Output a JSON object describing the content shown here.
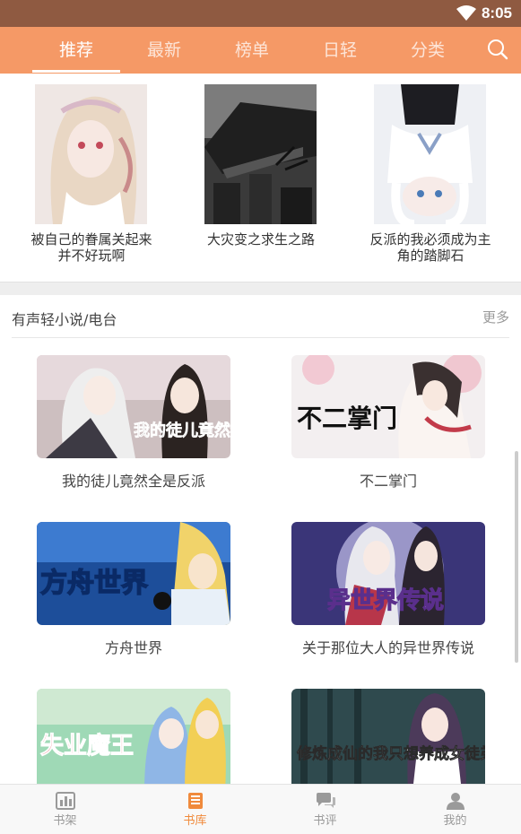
{
  "status": {
    "time": "8:05",
    "wifi_icon": "wifi-icon"
  },
  "nav": {
    "tabs": [
      {
        "label": "推荐",
        "active": true
      },
      {
        "label": "最新"
      },
      {
        "label": "榜单"
      },
      {
        "label": "日轻"
      },
      {
        "label": "分类"
      }
    ],
    "search_icon": "search-icon",
    "accent_color": "#f59966"
  },
  "books": [
    {
      "title": "被自己的眷属关起来并不好玩啊"
    },
    {
      "title": "大灾变之求生之路"
    },
    {
      "title": "反派的我必须成为主角的踏脚石"
    }
  ],
  "audio_section": {
    "title": "有声轻小说/电台",
    "more": "更多",
    "items": [
      {
        "title": "我的徒儿竟然全是反派",
        "cover_text": "我的徒儿竟然全是反派"
      },
      {
        "title": "不二掌门",
        "cover_text": "不二掌门"
      },
      {
        "title": "方舟世界",
        "cover_text": "方舟世界"
      },
      {
        "title": "关于那位大人的异世界传说",
        "cover_text": "异世界传说"
      },
      {
        "title": "",
        "cover_text": "失业魔王"
      },
      {
        "title": "",
        "cover_text": "修炼成仙的我只想养成女徒弟"
      }
    ]
  },
  "bottom_nav": [
    {
      "label": "书架",
      "icon": "bookshelf-icon"
    },
    {
      "label": "书库",
      "icon": "library-icon",
      "active": true
    },
    {
      "label": "书评",
      "icon": "comments-icon"
    },
    {
      "label": "我的",
      "icon": "profile-icon"
    }
  ]
}
